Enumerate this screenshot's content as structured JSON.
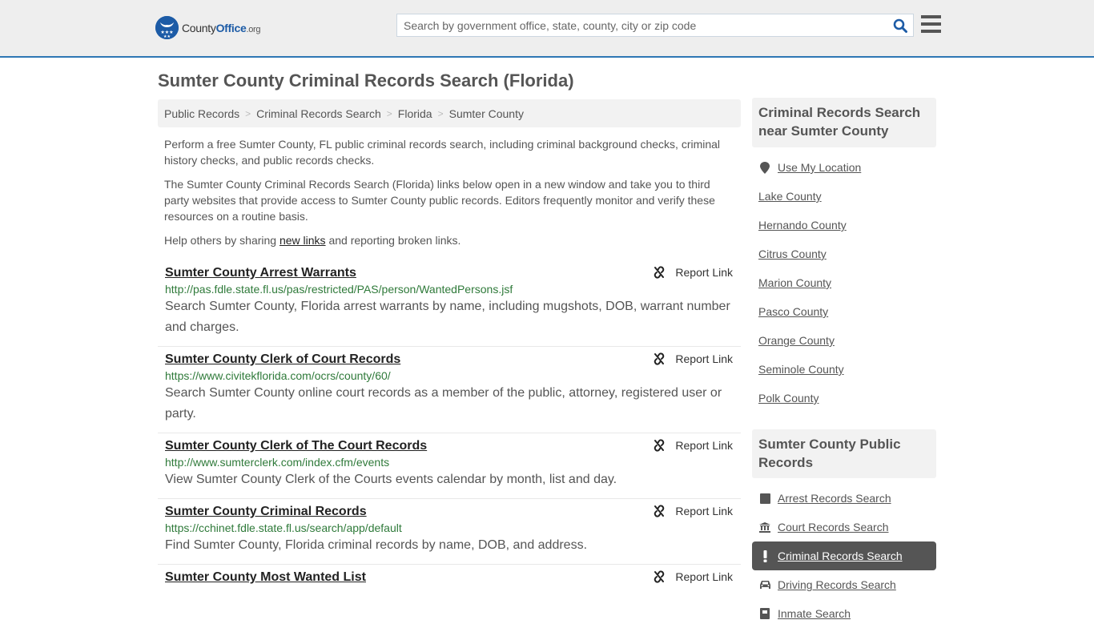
{
  "header": {
    "logo_text_main": "County",
    "logo_text_brand": "Office",
    "logo_text_tld": ".org",
    "search_placeholder": "Search by government office, state, county, city or zip code",
    "brand_color": "#1c5ba6",
    "accent_border_color": "#2e77b4"
  },
  "page": {
    "title": "Sumter County Criminal Records Search (Florida)"
  },
  "breadcrumb": [
    {
      "label": "Public Records"
    },
    {
      "label": "Criminal Records Search"
    },
    {
      "label": "Florida"
    },
    {
      "label": "Sumter County"
    }
  ],
  "intro": {
    "p1": "Perform a free Sumter County, FL public criminal records search, including criminal background checks, criminal history checks, and public records checks.",
    "p2": "The Sumter County Criminal Records Search (Florida) links below open in a new window and take you to third party websites that provide access to Sumter County public records. Editors frequently monitor and verify these resources on a routine basis.",
    "p3_before": "Help others by sharing ",
    "p3_link": "new links",
    "p3_after": " and reporting broken links."
  },
  "report_label": "Report Link",
  "results": [
    {
      "title": "Sumter County Arrest Warrants",
      "url": "http://pas.fdle.state.fl.us/pas/restricted/PAS/person/WantedPersons.jsf",
      "description": "Search Sumter County, Florida arrest warrants by name, including mugshots, DOB, warrant number and charges."
    },
    {
      "title": "Sumter County Clerk of Court Records",
      "url": "https://www.civitekflorida.com/ocrs/county/60/",
      "description": "Search Sumter County online court records as a member of the public, attorney, registered user or party."
    },
    {
      "title": "Sumter County Clerk of The Court Records",
      "url": "http://www.sumterclerk.com/index.cfm/events",
      "description": "View Sumter County Clerk of the Courts events calendar by month, list and day."
    },
    {
      "title": "Sumter County Criminal Records",
      "url": "https://cchinet.fdle.state.fl.us/search/app/default",
      "description": "Find Sumter County, Florida criminal records by name, DOB, and address."
    },
    {
      "title": "Sumter County Most Wanted List",
      "url": "",
      "description": ""
    }
  ],
  "sidebar_nearby": {
    "heading": "Criminal Records Search near Sumter County",
    "use_location": "Use My Location",
    "items": [
      {
        "label": "Lake County"
      },
      {
        "label": "Hernando County"
      },
      {
        "label": "Citrus County"
      },
      {
        "label": "Marion County"
      },
      {
        "label": "Pasco County"
      },
      {
        "label": "Orange County"
      },
      {
        "label": "Seminole County"
      },
      {
        "label": "Polk County"
      }
    ]
  },
  "sidebar_public": {
    "heading": "Sumter County Public Records",
    "items": [
      {
        "label": "Arrest Records Search",
        "icon": "square-icon",
        "active": false
      },
      {
        "label": "Court Records Search",
        "icon": "courthouse-icon",
        "active": false
      },
      {
        "label": "Criminal Records Search",
        "icon": "exclamation-icon",
        "active": true
      },
      {
        "label": "Driving Records Search",
        "icon": "car-icon",
        "active": false
      },
      {
        "label": "Inmate Search",
        "icon": "inmate-icon",
        "active": false
      }
    ]
  }
}
